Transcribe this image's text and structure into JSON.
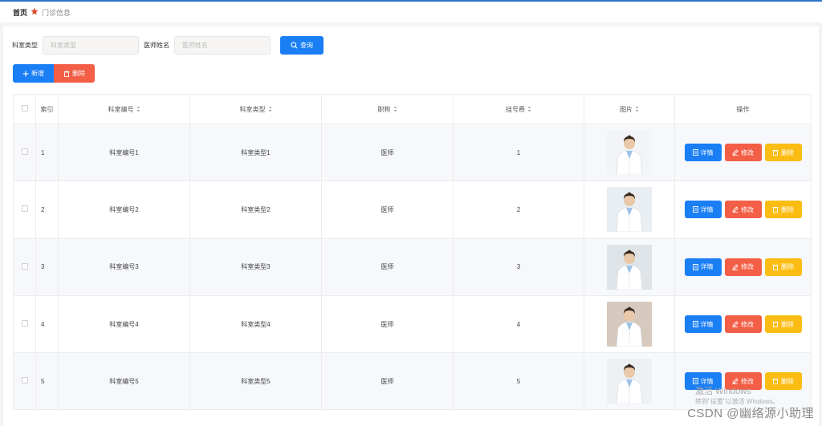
{
  "breadcrumb": {
    "home": "首页",
    "separator": "✡",
    "current": "门诊信息"
  },
  "search": {
    "dept_type_label": "科室类型",
    "dept_type_placeholder": "科室类型",
    "doctor_name_label": "医师姓名",
    "doctor_name_placeholder": "医师姓名",
    "search_button": "查询"
  },
  "actions": {
    "add_button": "新增",
    "delete_button": "删除"
  },
  "table": {
    "headers": {
      "index": "索引",
      "dept_code": "科室编号",
      "dept_type": "科室类型",
      "title": "职称",
      "fee": "挂号费",
      "photo": "图片",
      "operations": "操作"
    },
    "rows": [
      {
        "index": "1",
        "dept_code": "科室编号1",
        "dept_type": "科室类型1",
        "title": "医师",
        "fee": "1"
      },
      {
        "index": "2",
        "dept_code": "科室编号2",
        "dept_type": "科室类型2",
        "title": "医师",
        "fee": "2"
      },
      {
        "index": "3",
        "dept_code": "科室编号3",
        "dept_type": "科室类型3",
        "title": "医师",
        "fee": "3"
      },
      {
        "index": "4",
        "dept_code": "科室编号4",
        "dept_type": "科室类型4",
        "title": "医师",
        "fee": "4"
      },
      {
        "index": "5",
        "dept_code": "科室编号5",
        "dept_type": "科室类型5",
        "title": "医师",
        "fee": "5"
      }
    ],
    "row_buttons": {
      "detail": "详情",
      "edit": "修改",
      "delete": "删除"
    }
  },
  "overlay": {
    "watermark": "CSDN @幽络源小助理",
    "windows_activate": "激活 Windows",
    "windows_activate_hint": "转到\"设置\"以激活 Windows。"
  },
  "colors": {
    "primary": "#1a7ef5",
    "danger": "#f35e46",
    "warning": "#fbbd13",
    "accent_line": "#2b73c9"
  }
}
